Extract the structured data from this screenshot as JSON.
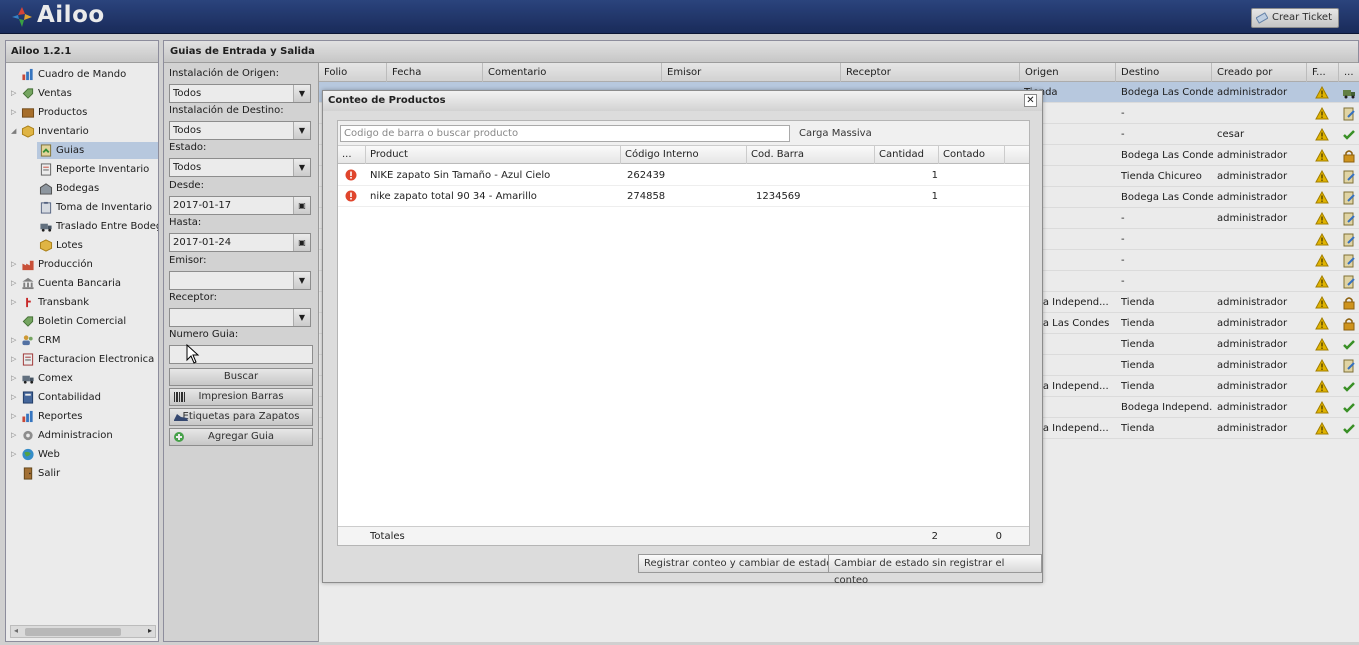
{
  "app": {
    "logo_text": "Ailoo",
    "ticket_button": "Crear Ticket",
    "version": "Ailoo 1.2.1"
  },
  "colors": {
    "header": "#1f3368",
    "selection": "#c7d9f1",
    "warning": "#f0b400",
    "check": "#3f9d2a",
    "error": "#d9432b"
  },
  "sidebar": {
    "items": [
      {
        "label": "Cuadro de Mando",
        "icon": "chart-icon",
        "indent": 0,
        "arrow": ""
      },
      {
        "label": "Ventas",
        "icon": "tag-icon",
        "indent": 0,
        "arrow": "▷"
      },
      {
        "label": "Productos",
        "icon": "box-icon",
        "indent": 0,
        "arrow": "▷"
      },
      {
        "label": "Inventario",
        "icon": "cube-icon",
        "indent": 0,
        "arrow": "◢"
      },
      {
        "label": "Guias",
        "icon": "guide-icon",
        "indent": 1,
        "arrow": ""
      },
      {
        "label": "Reporte Inventario",
        "icon": "report-icon",
        "indent": 1,
        "arrow": ""
      },
      {
        "label": "Bodegas",
        "icon": "warehouse-icon",
        "indent": 1,
        "arrow": ""
      },
      {
        "label": "Toma de Inventario",
        "icon": "clipboard-icon",
        "indent": 1,
        "arrow": ""
      },
      {
        "label": "Traslado Entre Bodegas",
        "icon": "truck-icon",
        "indent": 1,
        "arrow": ""
      },
      {
        "label": "Lotes",
        "icon": "cube-icon",
        "indent": 1,
        "arrow": ""
      },
      {
        "label": "Producción",
        "icon": "factory-icon",
        "indent": 0,
        "arrow": "▷"
      },
      {
        "label": "Cuenta Bancaria",
        "icon": "bank-icon",
        "indent": 0,
        "arrow": "▷"
      },
      {
        "label": "Transbank",
        "icon": "transbank-icon",
        "indent": 0,
        "arrow": "▷"
      },
      {
        "label": "Boletin Comercial",
        "icon": "tag-icon",
        "indent": 0,
        "arrow": ""
      },
      {
        "label": "CRM",
        "icon": "users-icon",
        "indent": 0,
        "arrow": "▷"
      },
      {
        "label": "Facturacion Electronica",
        "icon": "invoice-icon",
        "indent": 0,
        "arrow": "▷"
      },
      {
        "label": "Comex",
        "icon": "truck-icon",
        "indent": 0,
        "arrow": "▷"
      },
      {
        "label": "Contabilidad",
        "icon": "ledger-icon",
        "indent": 0,
        "arrow": "▷"
      },
      {
        "label": "Reportes",
        "icon": "chart-icon",
        "indent": 0,
        "arrow": "▷"
      },
      {
        "label": "Administracion",
        "icon": "gear-icon",
        "indent": 0,
        "arrow": "▷"
      },
      {
        "label": "Web",
        "icon": "globe-icon",
        "indent": 0,
        "arrow": "▷"
      },
      {
        "label": "Salir",
        "icon": "door-icon",
        "indent": 0,
        "arrow": ""
      }
    ]
  },
  "main": {
    "title": "Guias de Entrada y Salida",
    "filters": {
      "origen_label": "Instalación de Origen:",
      "origen_value": "Todos",
      "destino_label": "Instalación de Destino:",
      "destino_value": "Todos",
      "estado_label": "Estado:",
      "estado_value": "Todos",
      "desde_label": "Desde:",
      "desde_value": "2017-01-17",
      "hasta_label": "Hasta:",
      "hasta_value": "2017-01-24",
      "emisor_label": "Emisor:",
      "emisor_value": "",
      "receptor_label": "Receptor:",
      "receptor_value": "",
      "numero_label": "Numero Guia:",
      "numero_value": "",
      "buscar": "Buscar",
      "impresion": "Impresion Barras",
      "etiquetas": "Etiquetas para Zapatos",
      "agregar": "Agregar Guia"
    },
    "grid": {
      "columns": [
        "Folio",
        "Fecha",
        "Comentario",
        "Emisor",
        "Receptor",
        "Origen",
        "Destino",
        "Creado por",
        "F...",
        "..."
      ],
      "rows": [
        {
          "origen": "Tienda",
          "destino": "Bodega Las Condes",
          "creado": "administrador",
          "status": "truck"
        },
        {
          "origen": "da",
          "destino": "-",
          "creado": "",
          "status": "doc"
        },
        {
          "origen": "da",
          "destino": "-",
          "creado": "cesar",
          "status": "check"
        },
        {
          "origen": "da",
          "destino": "Bodega Las Condes",
          "creado": "administrador",
          "status": "lock"
        },
        {
          "origen": "",
          "destino": "Tienda Chicureo",
          "creado": "administrador",
          "status": "doc"
        },
        {
          "origen": "",
          "destino": "Bodega Las Condes",
          "creado": "administrador",
          "status": "doc"
        },
        {
          "origen": "da",
          "destino": "-",
          "creado": "administrador",
          "status": "doc"
        },
        {
          "origen": "da",
          "destino": "-",
          "creado": "",
          "status": "doc"
        },
        {
          "origen": "da",
          "destino": "-",
          "creado": "",
          "status": "doc"
        },
        {
          "origen": "da",
          "destino": "-",
          "creado": "",
          "status": "doc"
        },
        {
          "origen": "dega Independ...",
          "destino": "Tienda",
          "creado": "administrador",
          "status": "lock"
        },
        {
          "origen": "dega Las Condes",
          "destino": "Tienda",
          "creado": "administrador",
          "status": "lock"
        },
        {
          "origen": "",
          "destino": "Tienda",
          "creado": "administrador",
          "status": "check"
        },
        {
          "origen": "",
          "destino": "Tienda",
          "creado": "administrador",
          "status": "doc"
        },
        {
          "origen": "dega Independ...",
          "destino": "Tienda",
          "creado": "administrador",
          "status": "check"
        },
        {
          "origen": "",
          "destino": "Bodega Independ...",
          "creado": "administrador",
          "status": "check"
        },
        {
          "origen": "dega Independ...",
          "destino": "Tienda",
          "creado": "administrador",
          "status": "check"
        }
      ]
    }
  },
  "modal": {
    "title": "Conteo de Productos",
    "search_placeholder": "Codigo de barra o buscar producto",
    "carga_masiva": "Carga Massiva",
    "columns": [
      "...",
      "Product",
      "Código Interno",
      "Cod. Barra",
      "Cantidad",
      "Contado"
    ],
    "rows": [
      {
        "product": "NIKE zapato Sin Tamaño - Azul Cielo",
        "codigo": "262439",
        "barra": "",
        "cantidad": "1",
        "contado": ""
      },
      {
        "product": "nike zapato total 90 34 - Amarillo",
        "codigo": "274858",
        "barra": "1234569",
        "cantidad": "1",
        "contado": ""
      }
    ],
    "totals_label": "Totales",
    "totals_cantidad": "2",
    "totals_contado": "0",
    "btn_registrar": "Registrar conteo y cambiar de estado",
    "btn_cambiar": "Cambiar de estado sin registrar el conteo"
  }
}
